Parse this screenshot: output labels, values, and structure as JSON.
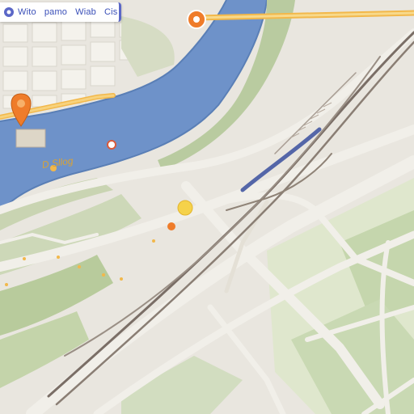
{
  "search_pill": {
    "left_label": "Wito",
    "middle_label": "pamo",
    "right_label": "Wiab",
    "far_label": "Cis"
  },
  "river_label": "D Sllog",
  "top_pin_label": "",
  "colors": {
    "water": "#6e92c9",
    "road_major": "#f1efe9",
    "road_yellow": "#f2b84b",
    "park": "#c9d9b3",
    "rail": "#7a6e66",
    "pin_orange": "#ef7c2a",
    "pin_yellow": "#f5d24a"
  },
  "icons": [
    "location-icon",
    "map-pin-icon",
    "poi-marker-icon"
  ]
}
